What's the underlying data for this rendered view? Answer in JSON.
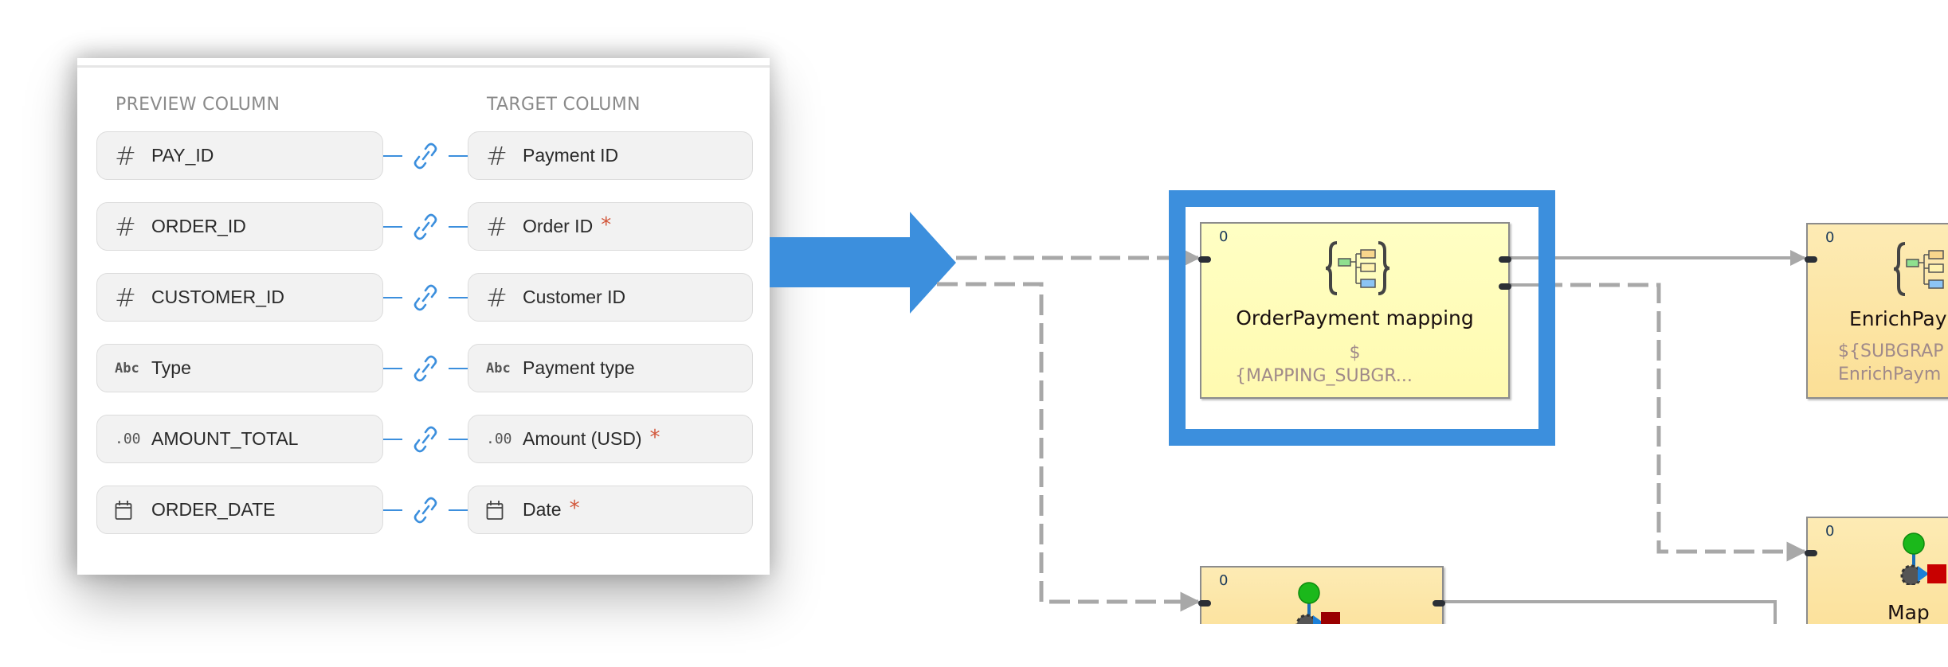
{
  "mapping_panel": {
    "headers": {
      "preview": "PREVIEW COLUMN",
      "target": "TARGET COLUMN"
    },
    "rows": [
      {
        "source": {
          "type_icon": "hash-icon",
          "type_glyph": "#",
          "label": "PAY_ID"
        },
        "link_icon": "link-icon",
        "target": {
          "type_icon": "hash-icon",
          "type_glyph": "#",
          "label": "Payment ID",
          "required": ""
        }
      },
      {
        "source": {
          "type_icon": "hash-icon",
          "type_glyph": "#",
          "label": "ORDER_ID"
        },
        "link_icon": "link-icon",
        "target": {
          "type_icon": "hash-icon",
          "type_glyph": "#",
          "label": "Order ID",
          "required": "*"
        }
      },
      {
        "source": {
          "type_icon": "hash-icon",
          "type_glyph": "#",
          "label": "CUSTOMER_ID"
        },
        "link_icon": "link-icon",
        "target": {
          "type_icon": "hash-icon",
          "type_glyph": "#",
          "label": "Customer ID",
          "required": ""
        }
      },
      {
        "source": {
          "type_icon": "text-type-icon",
          "type_glyph": "Abc",
          "label": "Type"
        },
        "link_icon": "link-icon",
        "target": {
          "type_icon": "text-type-icon",
          "type_glyph": "Abc",
          "label": "Payment type",
          "required": ""
        }
      },
      {
        "source": {
          "type_icon": "decimal-type-icon",
          "type_glyph": ".00",
          "label": "AMOUNT_TOTAL"
        },
        "link_icon": "link-icon",
        "target": {
          "type_icon": "decimal-type-icon",
          "type_glyph": ".00",
          "label": "Amount (USD)",
          "required": "*"
        }
      },
      {
        "source": {
          "type_icon": "calendar-icon",
          "type_glyph": "",
          "label": "ORDER_DATE"
        },
        "link_icon": "link-icon",
        "target": {
          "type_icon": "calendar-icon",
          "type_glyph": "",
          "label": "Date",
          "required": "*"
        }
      }
    ]
  },
  "graph": {
    "nodes": {
      "order_payment_mapping": {
        "count": "0",
        "title": "OrderPayment mapping",
        "subtitle_line1": "$",
        "subtitle_line2": "{MAPPING_SUBGR...",
        "icon": "mapping-subgraph-icon",
        "highlighted": true
      },
      "enrich_payment": {
        "count": "0",
        "title": "EnrichPay",
        "subtitle_line1": "${SUBGRAP",
        "subtitle_line2": "EnrichPaym",
        "icon": "mapping-subgraph-icon"
      },
      "bottom_left": {
        "count": "0",
        "icon": "reformat-component-icon"
      },
      "bottom_right": {
        "count": "0",
        "title": "Map",
        "icon": "reformat-component-icon"
      }
    }
  },
  "colors": {
    "accent_blue": "#3c8fdd",
    "required_star": "#d2563a",
    "mapping_node_fill": "#ffffc4",
    "component_node_fill": "#fde6a8",
    "edge_gray": "#a8a8a8"
  }
}
